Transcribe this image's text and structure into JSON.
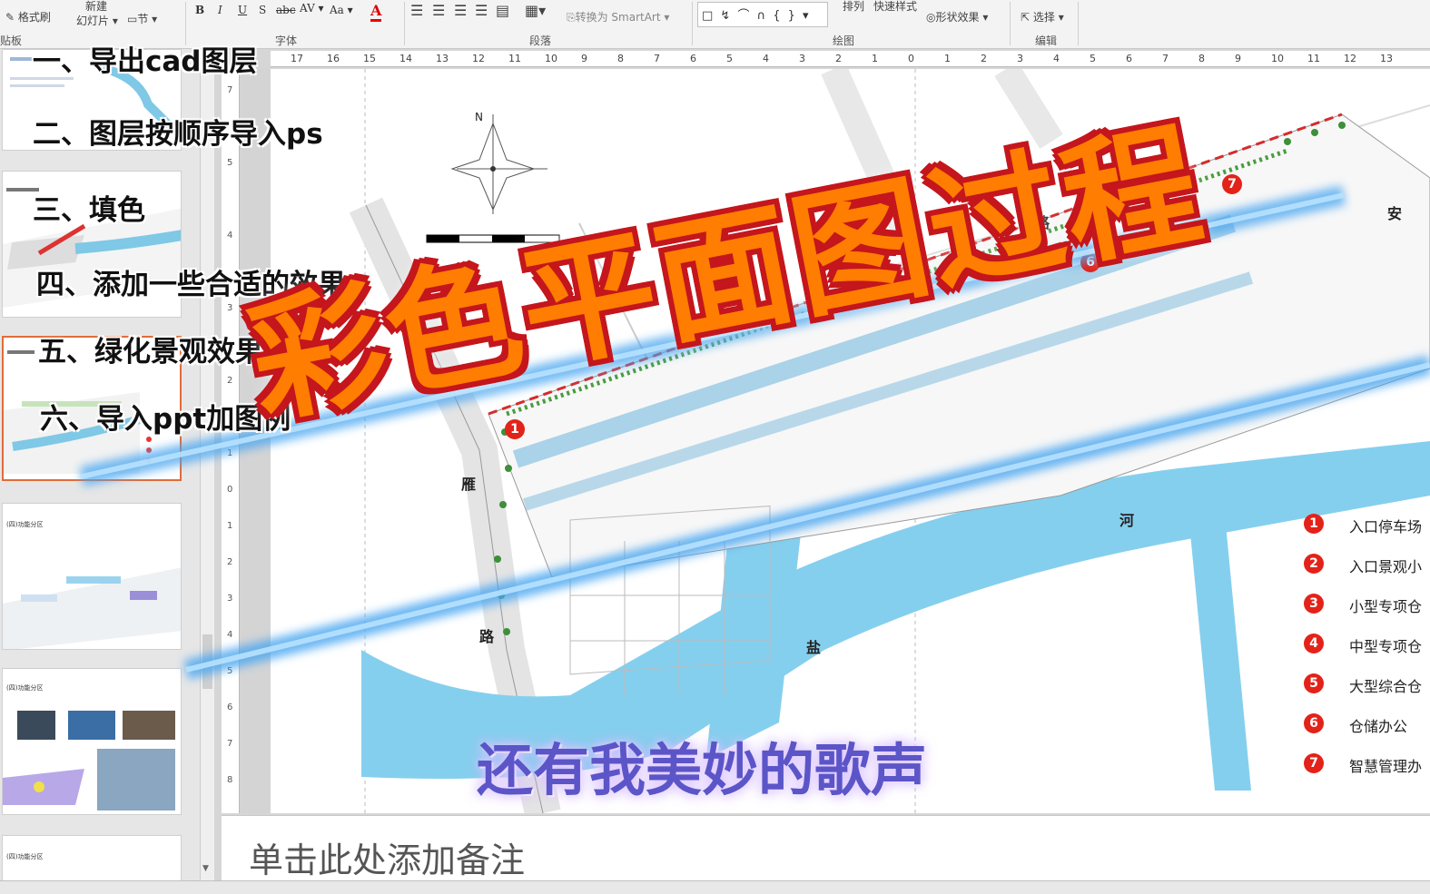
{
  "ribbon": {
    "format_painter": "格式刷",
    "new_slide": "新建",
    "slide_label": "幻灯片",
    "section": "节",
    "clipboard": "贴板",
    "font_group": "字体",
    "paragraph_group": "段落",
    "drawing_group": "绘图",
    "editing_group": "编辑",
    "convert_smartart": "转换为 SmartArt",
    "arrange": "排列",
    "quick_styles": "快速样式",
    "shape_effects": "形状效果",
    "select": "选择",
    "bold": "B",
    "italic": "I",
    "underline": "U",
    "strike": "S",
    "abc": "abc",
    "spacing": "AV",
    "case": "Aa",
    "font_color": "A"
  },
  "ruler_numbers": [
    "17",
    "16",
    "15",
    "14",
    "13",
    "12",
    "11",
    "10",
    "9",
    "8",
    "7",
    "6",
    "5",
    "4",
    "3",
    "2",
    "1",
    "0",
    "1",
    "2",
    "3",
    "4",
    "5",
    "6",
    "7",
    "8",
    "9",
    "10",
    "11",
    "12",
    "13"
  ],
  "steps": [
    "一、导出cad图层",
    "二、图层按顺序导入ps",
    "三、填色",
    "四、添加一些合适的效果",
    "五、绿化景观效果",
    "六、导入ppt加图例"
  ],
  "title": "彩色平面图过程",
  "subtitle": "还有我美妙的歌声",
  "map_labels": {
    "road_top": "路",
    "an": "安",
    "fei": "飞",
    "yan_left": "雁",
    "road_left": "路",
    "he": "河",
    "yan_bottom": "盐"
  },
  "north": "N",
  "legend": [
    {
      "num": "1",
      "text": "入口停车场"
    },
    {
      "num": "2",
      "text": "入口景观小"
    },
    {
      "num": "3",
      "text": "小型专项仓"
    },
    {
      "num": "4",
      "text": "中型专项仓"
    },
    {
      "num": "5",
      "text": "大型综合仓"
    },
    {
      "num": "6",
      "text": "仓储办公"
    },
    {
      "num": "7",
      "text": "智慧管理办"
    }
  ],
  "map_markers": [
    "1",
    "6",
    "7"
  ],
  "notes": "单击此处添加备注",
  "thumb_caption": "(四)功能分区",
  "colors": {
    "water": "#85cfee",
    "title_fill": "#ff7d00",
    "title_outline": "#c4161c",
    "marker": "#e32219",
    "subtitle": "#5b55c8",
    "selected_border": "#e06c3a"
  }
}
